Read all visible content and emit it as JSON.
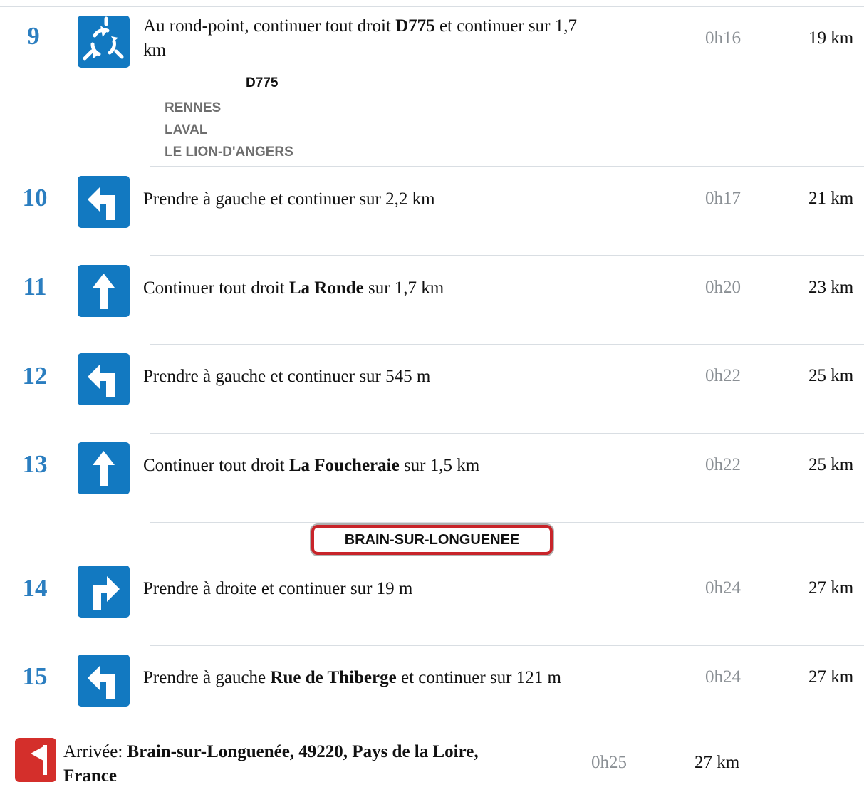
{
  "steps": [
    {
      "number": "9",
      "icon": "roundabout-icon",
      "text_before": "Au rond-point, continuer tout droit ",
      "road": "D775",
      "text_after": " et continuer sur 1,7",
      "text_line2": "km",
      "time": "0h16",
      "distance": "19 km",
      "direction_sign": {
        "road": "D775",
        "destinations": [
          "RENNES",
          "LAVAL",
          "LE LION-D'ANGERS"
        ]
      }
    },
    {
      "number": "10",
      "icon": "turn-left-icon",
      "text_before": "Prendre à gauche et continuer sur 2,2 km",
      "time": "0h17",
      "distance": "21 km"
    },
    {
      "number": "11",
      "icon": "straight-ahead-icon",
      "text_before": "Continuer tout droit ",
      "road": "La Ronde",
      "text_after": " sur 1,7 km",
      "time": "0h20",
      "distance": "23 km"
    },
    {
      "number": "12",
      "icon": "turn-left-icon",
      "text_before": "Prendre à gauche et continuer sur 545 m",
      "time": "0h22",
      "distance": "25 km"
    },
    {
      "number": "13",
      "icon": "straight-ahead-icon",
      "text_before": "Continuer tout droit ",
      "road": "La Foucheraie",
      "text_after": " sur 1,5 km",
      "time": "0h22",
      "distance": "25 km"
    },
    {
      "number": "14",
      "icon": "turn-right-icon",
      "town_sign": "BRAIN-SUR-LONGUENEE",
      "text_before": "Prendre à droite et continuer sur 19 m",
      "time": "0h24",
      "distance": "27 km"
    },
    {
      "number": "15",
      "icon": "turn-left-icon",
      "text_before": "Prendre à gauche ",
      "road": "Rue de Thiberge",
      "text_after": " et continuer sur 121 m",
      "time": "0h24",
      "distance": "27 km"
    }
  ],
  "arrival": {
    "icon": "arrival-flag-icon",
    "label": "Arrivée: ",
    "place_line1": "Brain-sur-Longuenée, 49220, Pays de la Loire,",
    "place_line2": "France",
    "time": "0h25",
    "distance": "27 km"
  },
  "colors": {
    "step_number": "#2b7ec0",
    "sign_blue": "#1279c1",
    "time_gray": "#8a8f94",
    "separator": "#d9dee3",
    "town_sign_red": "#c8242a",
    "arrival_red": "#d42f2b"
  }
}
